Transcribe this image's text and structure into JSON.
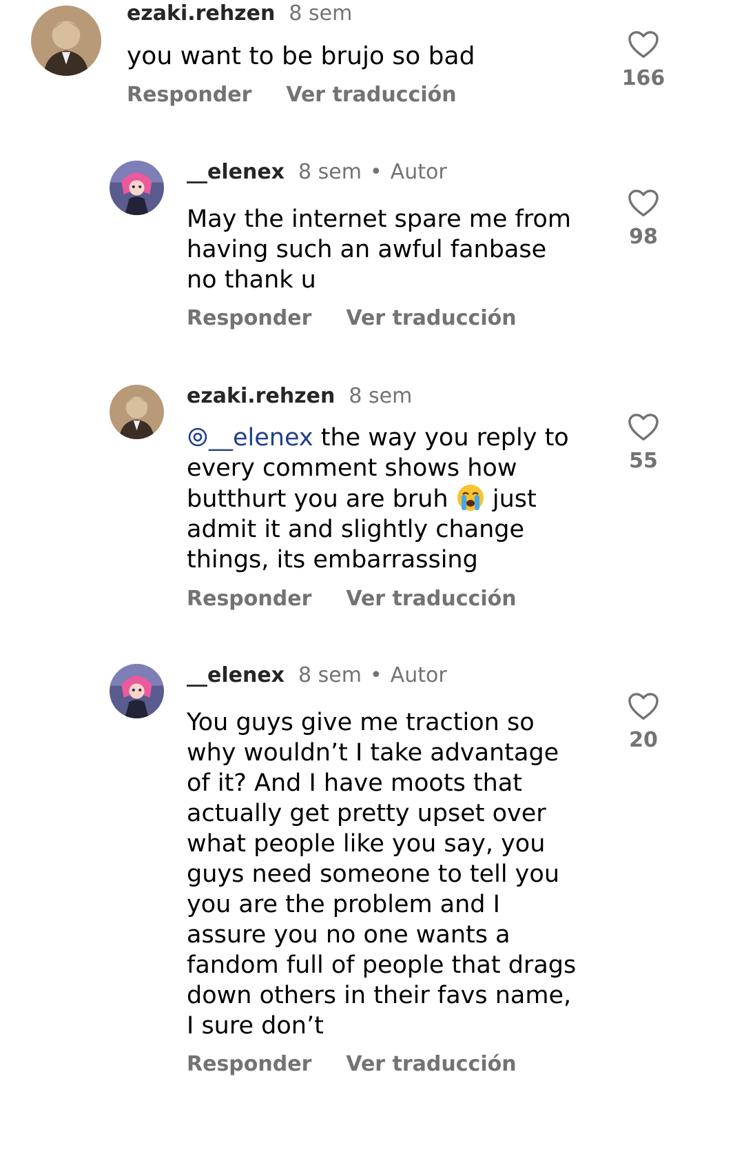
{
  "comments": [
    {
      "username": "ezaki.rehzen",
      "time": "8 sem",
      "author": "",
      "text": "you want to be brujo so bad",
      "reply_label": "Responder",
      "translate_label": "Ver traducción",
      "likes": "166"
    },
    {
      "username": "__elenex",
      "time": "8 sem",
      "author": "Autor",
      "text_lines": [
        "May the internet spare me from",
        "having such an awful fanbase",
        "no thank u"
      ],
      "reply_label": "Responder",
      "translate_label": "Ver traducción",
      "likes": "98"
    },
    {
      "username": "ezaki.rehzen",
      "time": "8 sem",
      "author": "",
      "mention": "__elenex",
      "text_lines": [
        " the way you reply to",
        "every comment shows how",
        "butthurt you are bruh",
        " just",
        "admit it and slightly change",
        "things, its embarrassing"
      ],
      "reply_label": "Responder",
      "translate_label": "Ver traducción",
      "likes": "55"
    },
    {
      "username": "__elenex",
      "time": "8 sem",
      "author": "Autor",
      "text_lines": [
        "You guys give me traction so",
        "why wouldn’t I take advantage",
        "of it? And I have moots that",
        "actually get pretty upset over",
        "what people like you say, you",
        "guys need someone to tell you",
        "you are the problem and I",
        "assure you no one wants a",
        "fandom full of people that drags",
        "down others in their favs name,",
        "I sure don’t"
      ],
      "reply_label": "Responder",
      "translate_label": "Ver traducción",
      "likes": "20"
    }
  ],
  "icons": {
    "like": "heart-outline-icon",
    "threads": "threads-icon",
    "emoji": "loudly-crying-face"
  },
  "colors": {
    "username": "#262626",
    "meta": "#737373",
    "mention": "#1f3f8a"
  }
}
